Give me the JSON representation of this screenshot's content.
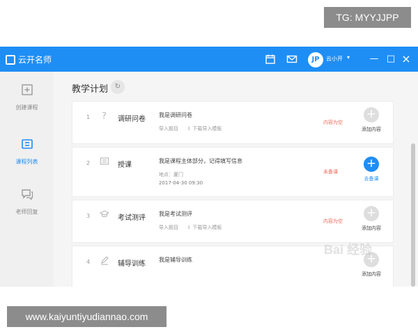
{
  "watermark": {
    "tag": "TG: MYYJJPP",
    "url": "www.kaiyuntiyudiannao.com",
    "baidu_overlay": "Bai 经验"
  },
  "titlebar": {
    "app_name": "云开名师",
    "avatar_text": "JP",
    "username": "云小开",
    "caret": "▾",
    "minimize": "—",
    "maximize": "□",
    "close": "×",
    "bg_color": "#1e8ef5"
  },
  "sidebar": {
    "items": [
      {
        "label": "创建课程",
        "icon": "create-course-icon"
      },
      {
        "label": "课程列表",
        "icon": "course-list-icon",
        "active": true
      },
      {
        "label": "老师回复",
        "icon": "teacher-reply-icon"
      }
    ]
  },
  "main": {
    "title": "教学计划",
    "refresh": "↻",
    "rows": [
      {
        "index": "1",
        "name": "调研问卷",
        "desc": "我是调研问卷",
        "links": [
          "导入题目",
          "下载导入模板"
        ],
        "status": "内容为空",
        "action": "添加内容",
        "icon": "question-icon"
      },
      {
        "index": "2",
        "name": "授课",
        "desc": "我是课程主体部分，记得填写信息",
        "meta1": "地点：厦门",
        "meta2": "2017-04-30 09:30",
        "status": "未备课",
        "action": "去备课",
        "icon": "lesson-icon"
      },
      {
        "index": "3",
        "name": "考试测评",
        "desc": "我是考试测评",
        "links": [
          "导入题目",
          "下载导入模板"
        ],
        "status": "内容为空",
        "action": "添加内容",
        "icon": "exam-icon"
      },
      {
        "index": "4",
        "name": "辅导训练",
        "desc": "我是辅导训练",
        "status": "",
        "action": "添加内容",
        "icon": "edit-icon"
      }
    ]
  },
  "colors": {
    "accent": "#1e8ef5",
    "warning": "#f26a5a"
  }
}
